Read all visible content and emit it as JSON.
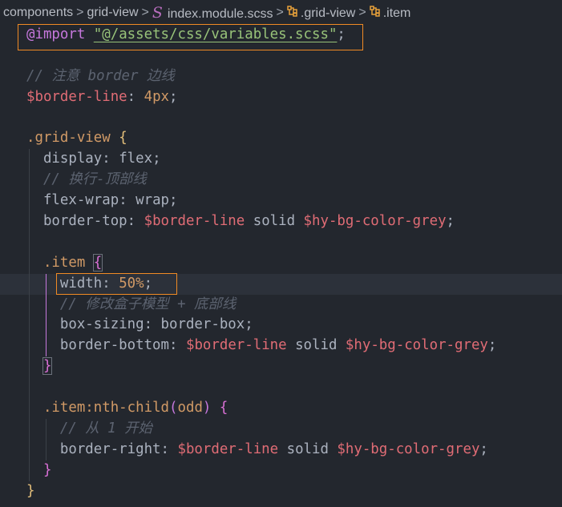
{
  "breadcrumb": {
    "items": [
      {
        "label": "components"
      },
      {
        "label": "grid-view"
      },
      {
        "label": "index.module.scss",
        "icon": "sass-icon"
      },
      {
        "label": ".grid-view",
        "icon": "symbol-class-icon"
      },
      {
        "label": ".item",
        "icon": "symbol-class-icon"
      }
    ],
    "separator": ">"
  },
  "colors": {
    "background": "#23272e",
    "highlight_box": "#f08a24",
    "at_rule": "#c678dd",
    "string": "#98c379",
    "variable": "#e06c75",
    "selector": "#d19a66",
    "comment": "#5c6370"
  },
  "editor": {
    "current_line": 12,
    "lines": [
      {
        "indent": 0,
        "tokens": [
          {
            "t": "@import",
            "c": "at"
          },
          {
            "t": " ",
            "c": "punc"
          },
          {
            "t": "\"@/assets/css/variables.scss\"",
            "c": "str"
          },
          {
            "t": ";",
            "c": "punc"
          }
        ]
      },
      {
        "indent": 0,
        "tokens": []
      },
      {
        "indent": 0,
        "tokens": [
          {
            "t": "// 注意 border 边线",
            "c": "cmt"
          }
        ]
      },
      {
        "indent": 0,
        "tokens": [
          {
            "t": "$border-line",
            "c": "var"
          },
          {
            "t": ": ",
            "c": "punc"
          },
          {
            "t": "4px",
            "c": "num"
          },
          {
            "t": ";",
            "c": "punc"
          }
        ]
      },
      {
        "indent": 0,
        "tokens": []
      },
      {
        "indent": 0,
        "tokens": [
          {
            "t": ".grid-view",
            "c": "sel"
          },
          {
            "t": " ",
            "c": "punc"
          },
          {
            "t": "{",
            "c": "b1"
          }
        ]
      },
      {
        "indent": 1,
        "tokens": [
          {
            "t": "display",
            "c": "prop"
          },
          {
            "t": ": flex;",
            "c": "punc"
          }
        ]
      },
      {
        "indent": 1,
        "tokens": [
          {
            "t": "// 换行-顶部线",
            "c": "cmt"
          }
        ]
      },
      {
        "indent": 1,
        "tokens": [
          {
            "t": "flex-wrap",
            "c": "prop"
          },
          {
            "t": ": wrap;",
            "c": "punc"
          }
        ]
      },
      {
        "indent": 1,
        "tokens": [
          {
            "t": "border-top",
            "c": "prop"
          },
          {
            "t": ": ",
            "c": "punc"
          },
          {
            "t": "$border-line",
            "c": "var"
          },
          {
            "t": " solid ",
            "c": "punc"
          },
          {
            "t": "$hy-bg-color-grey",
            "c": "var"
          },
          {
            "t": ";",
            "c": "punc"
          }
        ]
      },
      {
        "indent": 1,
        "tokens": []
      },
      {
        "indent": 1,
        "tokens": [
          {
            "t": ".item",
            "c": "sel"
          },
          {
            "t": " ",
            "c": "punc"
          },
          {
            "t": "{",
            "c": "b2"
          }
        ]
      },
      {
        "indent": 2,
        "tokens": [
          {
            "t": "width",
            "c": "prop"
          },
          {
            "t": ": ",
            "c": "punc"
          },
          {
            "t": "50%",
            "c": "num"
          },
          {
            "t": ";",
            "c": "punc"
          }
        ]
      },
      {
        "indent": 2,
        "tokens": [
          {
            "t": "// 修改盒子模型 + 底部线",
            "c": "cmt"
          }
        ]
      },
      {
        "indent": 2,
        "tokens": [
          {
            "t": "box-sizing",
            "c": "prop"
          },
          {
            "t": ": border-box;",
            "c": "punc"
          }
        ]
      },
      {
        "indent": 2,
        "tokens": [
          {
            "t": "border-bottom",
            "c": "prop"
          },
          {
            "t": ": ",
            "c": "punc"
          },
          {
            "t": "$border-line",
            "c": "var"
          },
          {
            "t": " solid ",
            "c": "punc"
          },
          {
            "t": "$hy-bg-color-grey",
            "c": "var"
          },
          {
            "t": ";",
            "c": "punc"
          }
        ]
      },
      {
        "indent": 1,
        "tokens": [
          {
            "t": "}",
            "c": "b2"
          }
        ]
      },
      {
        "indent": 1,
        "tokens": []
      },
      {
        "indent": 1,
        "tokens": [
          {
            "t": ".item:nth-child",
            "c": "sel"
          },
          {
            "t": "(",
            "c": "b3"
          },
          {
            "t": "odd",
            "c": "sel"
          },
          {
            "t": ")",
            "c": "b3"
          },
          {
            "t": " ",
            "c": "punc"
          },
          {
            "t": "{",
            "c": "b2"
          }
        ]
      },
      {
        "indent": 2,
        "tokens": [
          {
            "t": "// 从 1 开始",
            "c": "cmt"
          }
        ]
      },
      {
        "indent": 2,
        "tokens": [
          {
            "t": "border-right",
            "c": "prop"
          },
          {
            "t": ": ",
            "c": "punc"
          },
          {
            "t": "$border-line",
            "c": "var"
          },
          {
            "t": " solid ",
            "c": "punc"
          },
          {
            "t": "$hy-bg-color-grey",
            "c": "var"
          },
          {
            "t": ";",
            "c": "punc"
          }
        ]
      },
      {
        "indent": 1,
        "tokens": [
          {
            "t": "}",
            "c": "b2"
          }
        ]
      },
      {
        "indent": 0,
        "tokens": [
          {
            "t": "}",
            "c": "b1"
          }
        ]
      }
    ]
  }
}
